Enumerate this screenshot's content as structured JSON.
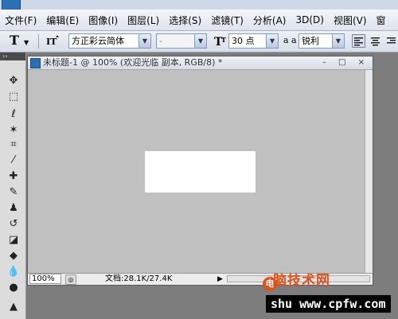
{
  "menubar": {
    "items": [
      "文件(F)",
      "编辑(E)",
      "图像(I)",
      "图层(L)",
      "选择(S)",
      "滤镜(T)",
      "分析(A)",
      "3D(D)",
      "视图(V)",
      "窗"
    ]
  },
  "options": {
    "tool_glyph": "T",
    "font_family": "方正彩云简体",
    "font_style": "-",
    "font_size": "30 点",
    "aa_label": "a a",
    "antialias": "锐利"
  },
  "toolbox": {
    "header": "››"
  },
  "document": {
    "title": "未标题-1 @ 100% (欢迎光临 副本, RGB/8) *",
    "window_buttons": "– □ ×",
    "zoom": "100%",
    "doc_info": "文档:28.1K/27.4K",
    "status_arrow": "▶"
  },
  "watermark": {
    "badge": "电",
    "line1": "脑技术网",
    "line2": "shu www.cpfw.com"
  }
}
